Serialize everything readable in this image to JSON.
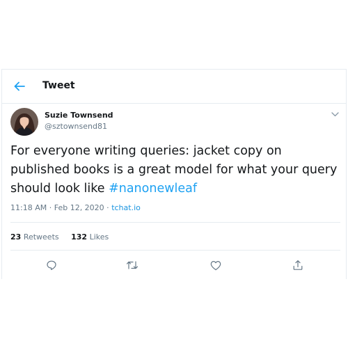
{
  "header": {
    "title": "Tweet",
    "back_icon": "arrow-left-icon"
  },
  "tweet": {
    "author_name": "Suzie Townsend",
    "author_handle": "@sztownsend81",
    "text_before_hashtag": "For everyone writing queries: jacket copy on published books is a great model for what your query should look like ",
    "hashtag": "#nanonewleaf",
    "time": "11:18 AM",
    "separator": " · ",
    "date": "Feb 12, 2020",
    "source": "tchat.io",
    "retweets_count": "23",
    "retweets_label": "Retweets",
    "likes_count": "132",
    "likes_label": "Likes"
  },
  "actions": [
    {
      "icon": "reply-icon"
    },
    {
      "icon": "retweet-icon"
    },
    {
      "icon": "like-icon"
    },
    {
      "icon": "share-icon"
    }
  ],
  "colors": {
    "accent": "#1da1f2",
    "text": "#14171a",
    "muted": "#657786",
    "border": "#e6ecf0"
  }
}
